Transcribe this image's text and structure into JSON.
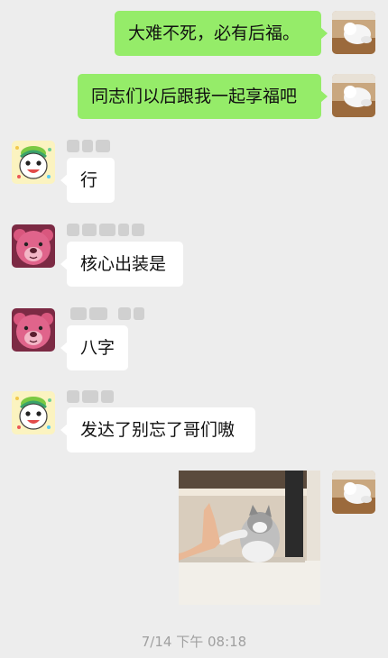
{
  "messages": [
    {
      "sender": "self",
      "text": "大难不死，必有后福。"
    },
    {
      "sender": "self",
      "text": "同志们以后跟我一起享福吧"
    },
    {
      "sender": "other",
      "avatar": "cartoon-avatar",
      "text": "行"
    },
    {
      "sender": "other",
      "avatar": "lotso-bear-avatar",
      "text": "核心出装是"
    },
    {
      "sender": "other",
      "avatar": "lotso-bear-avatar",
      "text": "八字"
    },
    {
      "sender": "other",
      "avatar": "cartoon-avatar",
      "text": "发达了别忘了哥们嗷"
    },
    {
      "sender": "self",
      "type": "image",
      "image": "cat-high-five-photo"
    }
  ],
  "timestamp": "7/14 下午 08:18",
  "colors": {
    "background": "#ededed",
    "self_bubble": "#95ec69",
    "other_bubble": "#ffffff",
    "timestamp_text": "#a0a0a0"
  }
}
